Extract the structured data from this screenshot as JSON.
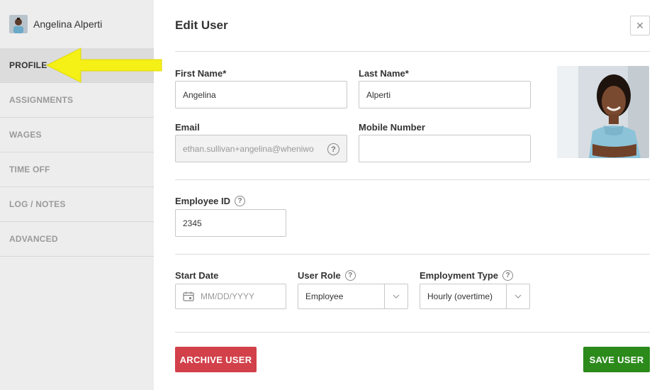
{
  "user": {
    "name": "Angelina Alperti"
  },
  "nav": {
    "items": [
      {
        "label": "PROFILE",
        "active": true
      },
      {
        "label": "ASSIGNMENTS"
      },
      {
        "label": "WAGES"
      },
      {
        "label": "TIME OFF"
      },
      {
        "label": "LOG / NOTES"
      },
      {
        "label": "ADVANCED"
      }
    ]
  },
  "form": {
    "title": "Edit User",
    "close_icon": "close-icon",
    "first_name": {
      "label": "First Name*",
      "value": "Angelina"
    },
    "last_name": {
      "label": "Last Name*",
      "value": "Alperti"
    },
    "email": {
      "label": "Email",
      "value": "ethan.sullivan+angelina@wheniwo"
    },
    "mobile": {
      "label": "Mobile Number",
      "value": ""
    },
    "employee_id": {
      "label": "Employee ID",
      "value": "2345"
    },
    "start_date": {
      "label": "Start Date",
      "placeholder": "MM/DD/YYYY"
    },
    "user_role": {
      "label": "User Role",
      "value": "Employee"
    },
    "employment_type": {
      "label": "Employment Type",
      "value": "Hourly (overtime)"
    },
    "help_glyph": "?"
  },
  "actions": {
    "archive_label": "ARCHIVE USER",
    "save_label": "SAVE USER"
  },
  "colors": {
    "archive": "#d2404a",
    "save": "#2c8a1b",
    "annotation_arrow": "#f5f016"
  }
}
